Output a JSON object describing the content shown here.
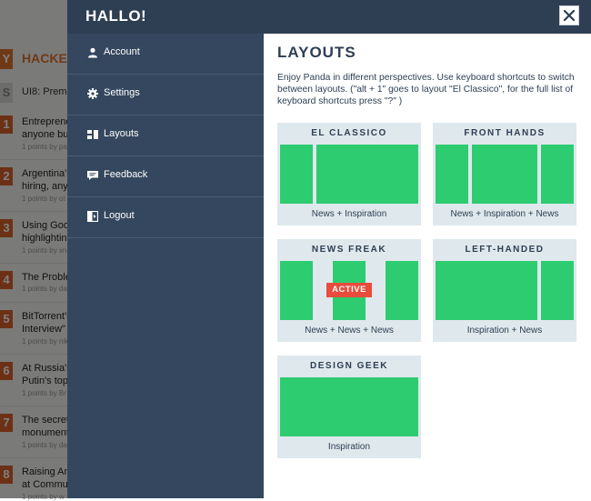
{
  "background": {
    "header": {
      "logo": "Y",
      "title": "HACKER"
    },
    "subheader": {
      "logo": "S",
      "text": "UI8: Premi"
    },
    "items": [
      {
        "num": "1",
        "line1": "Entreprene",
        "line2": "anyone buy",
        "meta": "1 points by pa"
      },
      {
        "num": "2",
        "line1": "Argentina's",
        "line2": "hiring, anyo",
        "meta": "1 points by ot"
      },
      {
        "num": "3",
        "line1": "Using Goog",
        "line2": "highlightin",
        "meta": "1 points by xn"
      },
      {
        "num": "4",
        "line1": "The Proble",
        "line2": "",
        "meta": "1 points by da"
      },
      {
        "num": "5",
        "line1": "BitTorrent's",
        "line2": "Interview\"",
        "meta": "1 points by nik"
      },
      {
        "num": "6",
        "line1": "At Russia's",
        "line2": "Putin's top",
        "meta": "1 points by Br"
      },
      {
        "num": "7",
        "line1": "The secret",
        "line2": "monument",
        "meta": "1 points by da"
      },
      {
        "num": "8",
        "line1": "Raising Am",
        "line2": "at Commu",
        "meta": "1 points by w"
      }
    ]
  },
  "panel": {
    "title": "HALLO!",
    "close_icon": "close-icon"
  },
  "sidebar": {
    "items": [
      {
        "label": "Account",
        "icon": "user-icon"
      },
      {
        "label": "Settings",
        "icon": "gear-icon"
      },
      {
        "label": "Layouts",
        "icon": "layout-icon"
      },
      {
        "label": "Feedback",
        "icon": "chat-icon"
      },
      {
        "label": "Logout",
        "icon": "logout-icon"
      }
    ]
  },
  "content": {
    "heading": "LAYOUTS",
    "description": "Enjoy Panda in different perspectives. Use keyboard shortcuts to switch between layouts. (\"alt + 1\" goes to layout \"El Classico\", for the full list of keyboard shortcuts press \"?\" )",
    "layouts": [
      {
        "name": "EL CLASSICO",
        "caption": "News + Inspiration",
        "active": false
      },
      {
        "name": "FRONT HANDS",
        "caption": "News + Inspiration + News",
        "active": false
      },
      {
        "name": "NEWS FREAK",
        "caption": "News + News + News",
        "active": true,
        "badge": "ACTIVE"
      },
      {
        "name": "LEFT-HANDED",
        "caption": "Inspiration + News",
        "active": false
      },
      {
        "name": "DESIGN GEEK",
        "caption": "Inspiration",
        "active": false
      }
    ]
  },
  "colors": {
    "header_bg": "#2e3e53",
    "sidebar_bg": "#34475e",
    "card_bg": "#dfe8ec",
    "pane_green": "#2ecc71",
    "active_red": "#e74c3c",
    "hn_orange": "#e0732a"
  }
}
